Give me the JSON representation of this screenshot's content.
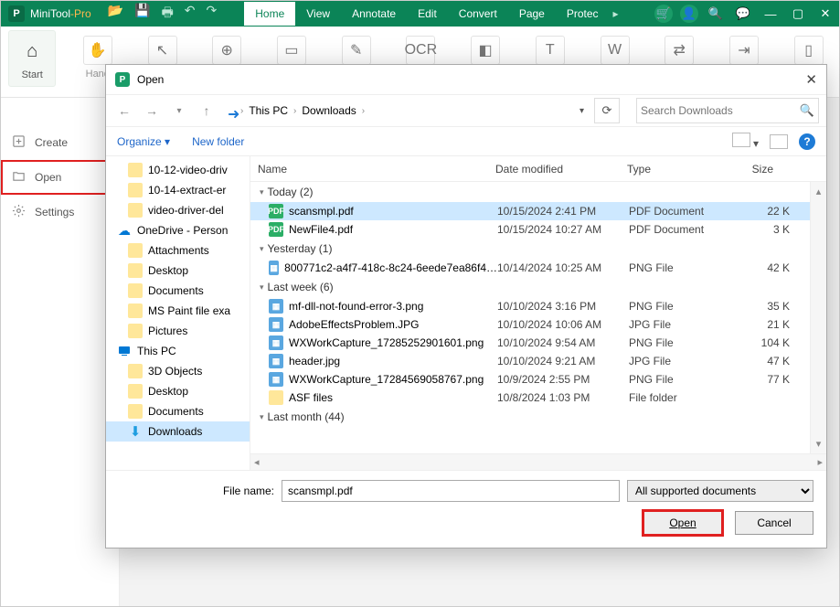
{
  "app": {
    "name_main": "MiniTool",
    "name_suffix": "-Pro",
    "tabs": [
      "Home",
      "View",
      "Annotate",
      "Edit",
      "Convert",
      "Page",
      "Protec"
    ],
    "active_tab": "Home"
  },
  "ribbon": {
    "tools": [
      {
        "label": "Start",
        "glyph": "⌂"
      },
      {
        "label": "Hand",
        "glyph": "✋"
      },
      {
        "label": "",
        "glyph": "↖"
      },
      {
        "label": "",
        "glyph": "⊕"
      },
      {
        "label": "",
        "glyph": "▭"
      },
      {
        "label": "",
        "glyph": "✎"
      },
      {
        "label": "",
        "glyph": "OCR"
      },
      {
        "label": "",
        "glyph": "◧"
      },
      {
        "label": "",
        "glyph": "T"
      },
      {
        "label": "",
        "glyph": "W"
      },
      {
        "label": "",
        "glyph": "⇄"
      },
      {
        "label": "",
        "glyph": "⇥"
      },
      {
        "label": "",
        "glyph": "▯"
      }
    ]
  },
  "sidebar": {
    "items": [
      {
        "label": "Create",
        "icon": "plus"
      },
      {
        "label": "Open",
        "icon": "folder",
        "highlight": true
      },
      {
        "label": "Settings",
        "icon": "gear"
      }
    ]
  },
  "dialog": {
    "title": "Open",
    "breadcrumb": [
      "This PC",
      "Downloads"
    ],
    "search_placeholder": "Search Downloads",
    "organize": "Organize",
    "newfolder": "New folder",
    "tree": [
      {
        "label": "10-12-video-driv",
        "icon": "folder",
        "indent": 1
      },
      {
        "label": "10-14-extract-er",
        "icon": "folder",
        "indent": 1
      },
      {
        "label": "video-driver-del",
        "icon": "folder",
        "indent": 1
      },
      {
        "label": "OneDrive - Person",
        "icon": "onedrive",
        "indent": 0
      },
      {
        "label": "Attachments",
        "icon": "folder",
        "indent": 1
      },
      {
        "label": "Desktop",
        "icon": "folder",
        "indent": 1
      },
      {
        "label": "Documents",
        "icon": "folder",
        "indent": 1
      },
      {
        "label": "MS Paint file exa",
        "icon": "folder",
        "indent": 1
      },
      {
        "label": "Pictures",
        "icon": "folder",
        "indent": 1
      },
      {
        "label": "This PC",
        "icon": "thispc",
        "indent": 0
      },
      {
        "label": "3D Objects",
        "icon": "folder",
        "indent": 1
      },
      {
        "label": "Desktop",
        "icon": "folder",
        "indent": 1
      },
      {
        "label": "Documents",
        "icon": "folder",
        "indent": 1
      },
      {
        "label": "Downloads",
        "icon": "dl",
        "indent": 1,
        "selected": true
      }
    ],
    "columns": {
      "name": "Name",
      "date": "Date modified",
      "type": "Type",
      "size": "Size"
    },
    "groups": [
      {
        "label": "Today (2)",
        "rows": [
          {
            "name": "scansmpl.pdf",
            "date": "10/15/2024 2:41 PM",
            "type": "PDF Document",
            "size": "22 K",
            "ft": "pdf",
            "selected": true
          },
          {
            "name": "NewFile4.pdf",
            "date": "10/15/2024 10:27 AM",
            "type": "PDF Document",
            "size": "3 K",
            "ft": "pdf"
          }
        ]
      },
      {
        "label": "Yesterday (1)",
        "rows": [
          {
            "name": "800771c2-a4f7-418c-8c24-6eede7ea86f4…",
            "date": "10/14/2024 10:25 AM",
            "type": "PNG File",
            "size": "42 K",
            "ft": "png"
          }
        ]
      },
      {
        "label": "Last week (6)",
        "rows": [
          {
            "name": "mf-dll-not-found-error-3.png",
            "date": "10/10/2024 3:16 PM",
            "type": "PNG File",
            "size": "35 K",
            "ft": "png"
          },
          {
            "name": "AdobeEffectsProblem.JPG",
            "date": "10/10/2024 10:06 AM",
            "type": "JPG File",
            "size": "21 K",
            "ft": "jpg"
          },
          {
            "name": "WXWorkCapture_17285252901601.png",
            "date": "10/10/2024 9:54 AM",
            "type": "PNG File",
            "size": "104 K",
            "ft": "png"
          },
          {
            "name": "header.jpg",
            "date": "10/10/2024 9:21 AM",
            "type": "JPG File",
            "size": "47 K",
            "ft": "jpg"
          },
          {
            "name": "WXWorkCapture_17284569058767.png",
            "date": "10/9/2024 2:55 PM",
            "type": "PNG File",
            "size": "77 K",
            "ft": "png"
          },
          {
            "name": "ASF files",
            "date": "10/8/2024 1:03 PM",
            "type": "File folder",
            "size": "",
            "ft": "folder2"
          }
        ]
      },
      {
        "label": "Last month (44)",
        "rows": []
      }
    ],
    "file_name_label": "File name:",
    "file_name_value": "scansmpl.pdf",
    "filter": "All supported documents",
    "open_btn": "Open",
    "cancel_btn": "Cancel"
  }
}
